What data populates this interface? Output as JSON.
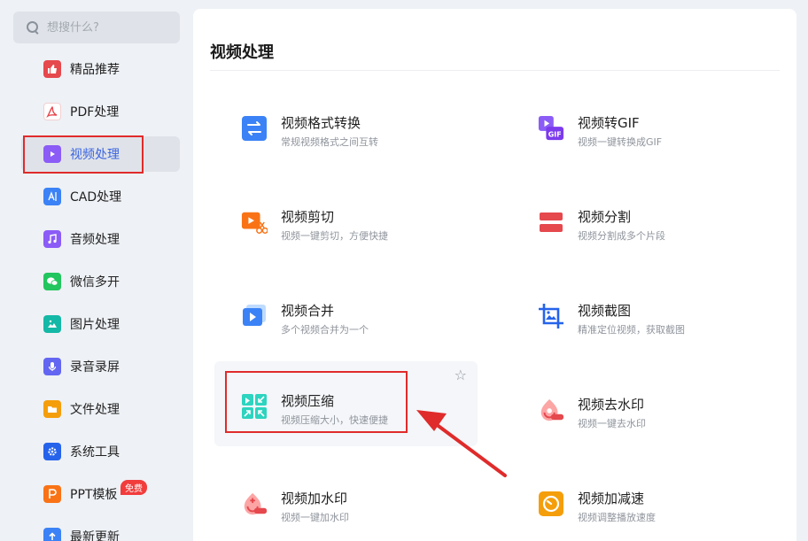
{
  "search": {
    "placeholder": "想搜什么?"
  },
  "sidebar": {
    "items": [
      {
        "label": "精品推荐",
        "icon": "thumbs-up-icon",
        "color": "#e5484d"
      },
      {
        "label": "PDF处理",
        "icon": "pdf-icon",
        "color": "#ffffff"
      },
      {
        "label": "视频处理",
        "icon": "play-icon",
        "color": "#8b5cf6"
      },
      {
        "label": "CAD处理",
        "icon": "cad-icon",
        "color": "#3b82f6"
      },
      {
        "label": "音频处理",
        "icon": "music-note-icon",
        "color": "#8b5cf6"
      },
      {
        "label": "微信多开",
        "icon": "wechat-icon",
        "color": "#22c55e"
      },
      {
        "label": "图片处理",
        "icon": "image-icon",
        "color": "#14b8a6"
      },
      {
        "label": "录音录屏",
        "icon": "microphone-icon",
        "color": "#6366f1"
      },
      {
        "label": "文件处理",
        "icon": "folder-icon",
        "color": "#f59e0b"
      },
      {
        "label": "系统工具",
        "icon": "gear-icon",
        "color": "#2563eb"
      },
      {
        "label": "PPT模板",
        "icon": "ppt-icon",
        "color": "#f97316",
        "badge": "免费"
      },
      {
        "label": "最新更新",
        "icon": "upload-icon",
        "color": "#3b82f6"
      }
    ]
  },
  "main": {
    "title": "视频处理",
    "tools": [
      {
        "title": "视频格式转换",
        "desc": "常规视频格式之间互转",
        "icon": "convert-icon"
      },
      {
        "title": "视频转GIF",
        "desc": "视频一键转换成GIF",
        "icon": "gif-icon"
      },
      {
        "title": "视频剪切",
        "desc": "视频一键剪切，方便快捷",
        "icon": "scissors-icon"
      },
      {
        "title": "视频分割",
        "desc": "视频分割成多个片段",
        "icon": "split-icon"
      },
      {
        "title": "视频合并",
        "desc": "多个视频合并为一个",
        "icon": "merge-icon"
      },
      {
        "title": "视频截图",
        "desc": "精准定位视频，获取截图",
        "icon": "crop-icon"
      },
      {
        "title": "视频压缩",
        "desc": "视频压缩大小，快速便捷",
        "icon": "compress-icon"
      },
      {
        "title": "视频去水印",
        "desc": "视频一键去水印",
        "icon": "remove-watermark-icon"
      },
      {
        "title": "视频加水印",
        "desc": "视频一键加水印",
        "icon": "add-watermark-icon"
      },
      {
        "title": "视频加减速",
        "desc": "视频调整播放速度",
        "icon": "speed-icon"
      }
    ]
  },
  "colors": {
    "accent": "#3a63e0",
    "highlight_red": "#e02b2b"
  }
}
